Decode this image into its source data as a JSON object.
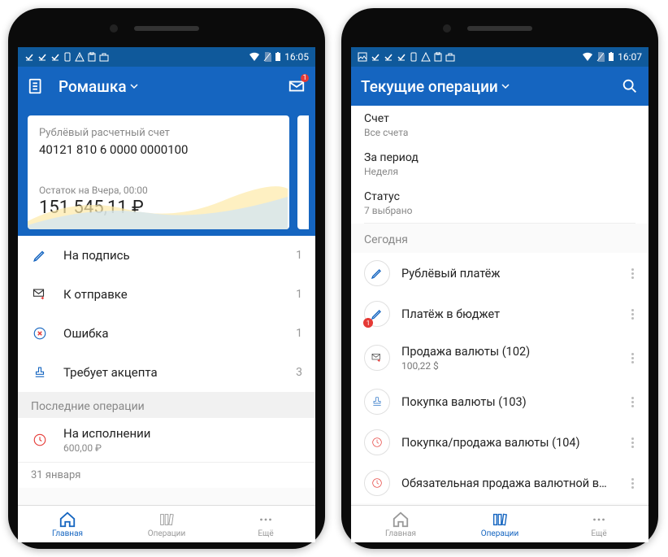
{
  "left": {
    "time": "16:05",
    "title": "Ромашка",
    "mail_badge": "1",
    "account": {
      "label": "Рублёвый расчетный счет",
      "number": "40121 810 6 0000 0000100",
      "balance_label": "Остаток на Вчера, 00:00",
      "balance": "151 545,11 ₽"
    },
    "statuses": [
      {
        "label": "На подпись",
        "count": "1",
        "icon": "pen"
      },
      {
        "label": "К отправке",
        "count": "1",
        "icon": "mail-arrow"
      },
      {
        "label": "Ошибка",
        "count": "1",
        "icon": "x-circle"
      },
      {
        "label": "Требует акцепта",
        "count": "3",
        "icon": "stamp"
      }
    ],
    "recent_header": "Последние операции",
    "recent_op": {
      "label": "На исполнении",
      "amount": "600,00 ₽",
      "icon": "clock"
    },
    "date_row": "31 января",
    "nav": {
      "home": "Главная",
      "ops": "Операции",
      "more": "Ещё"
    }
  },
  "right": {
    "time": "16:07",
    "title": "Текущие операции",
    "filters": {
      "account_label": "Счет",
      "account_value": "Все счета",
      "period_label": "За период",
      "period_value": "Неделя",
      "status_label": "Статус",
      "status_value": "7 выбрано"
    },
    "day_header": "Сегодня",
    "ops": [
      {
        "label": "Рублёвый платёж",
        "sub": "",
        "icon": "pen",
        "badge": false
      },
      {
        "label": "Платёж в бюджет",
        "sub": "",
        "icon": "pen",
        "badge": true
      },
      {
        "label": "Продажа валюты (102)",
        "sub": "100,22 $",
        "icon": "mail-arrow",
        "badge": false
      },
      {
        "label": "Покупка валюты (103)",
        "sub": "",
        "icon": "stamp",
        "badge": false
      },
      {
        "label": "Покупка/продажа валюты (104)",
        "sub": "",
        "icon": "clock",
        "badge": false
      },
      {
        "label": "Обязательная продажа валютной вы...",
        "sub": "",
        "icon": "clock",
        "badge": false
      }
    ],
    "nav": {
      "home": "Главная",
      "ops": "Операции",
      "more": "Ещё"
    }
  }
}
